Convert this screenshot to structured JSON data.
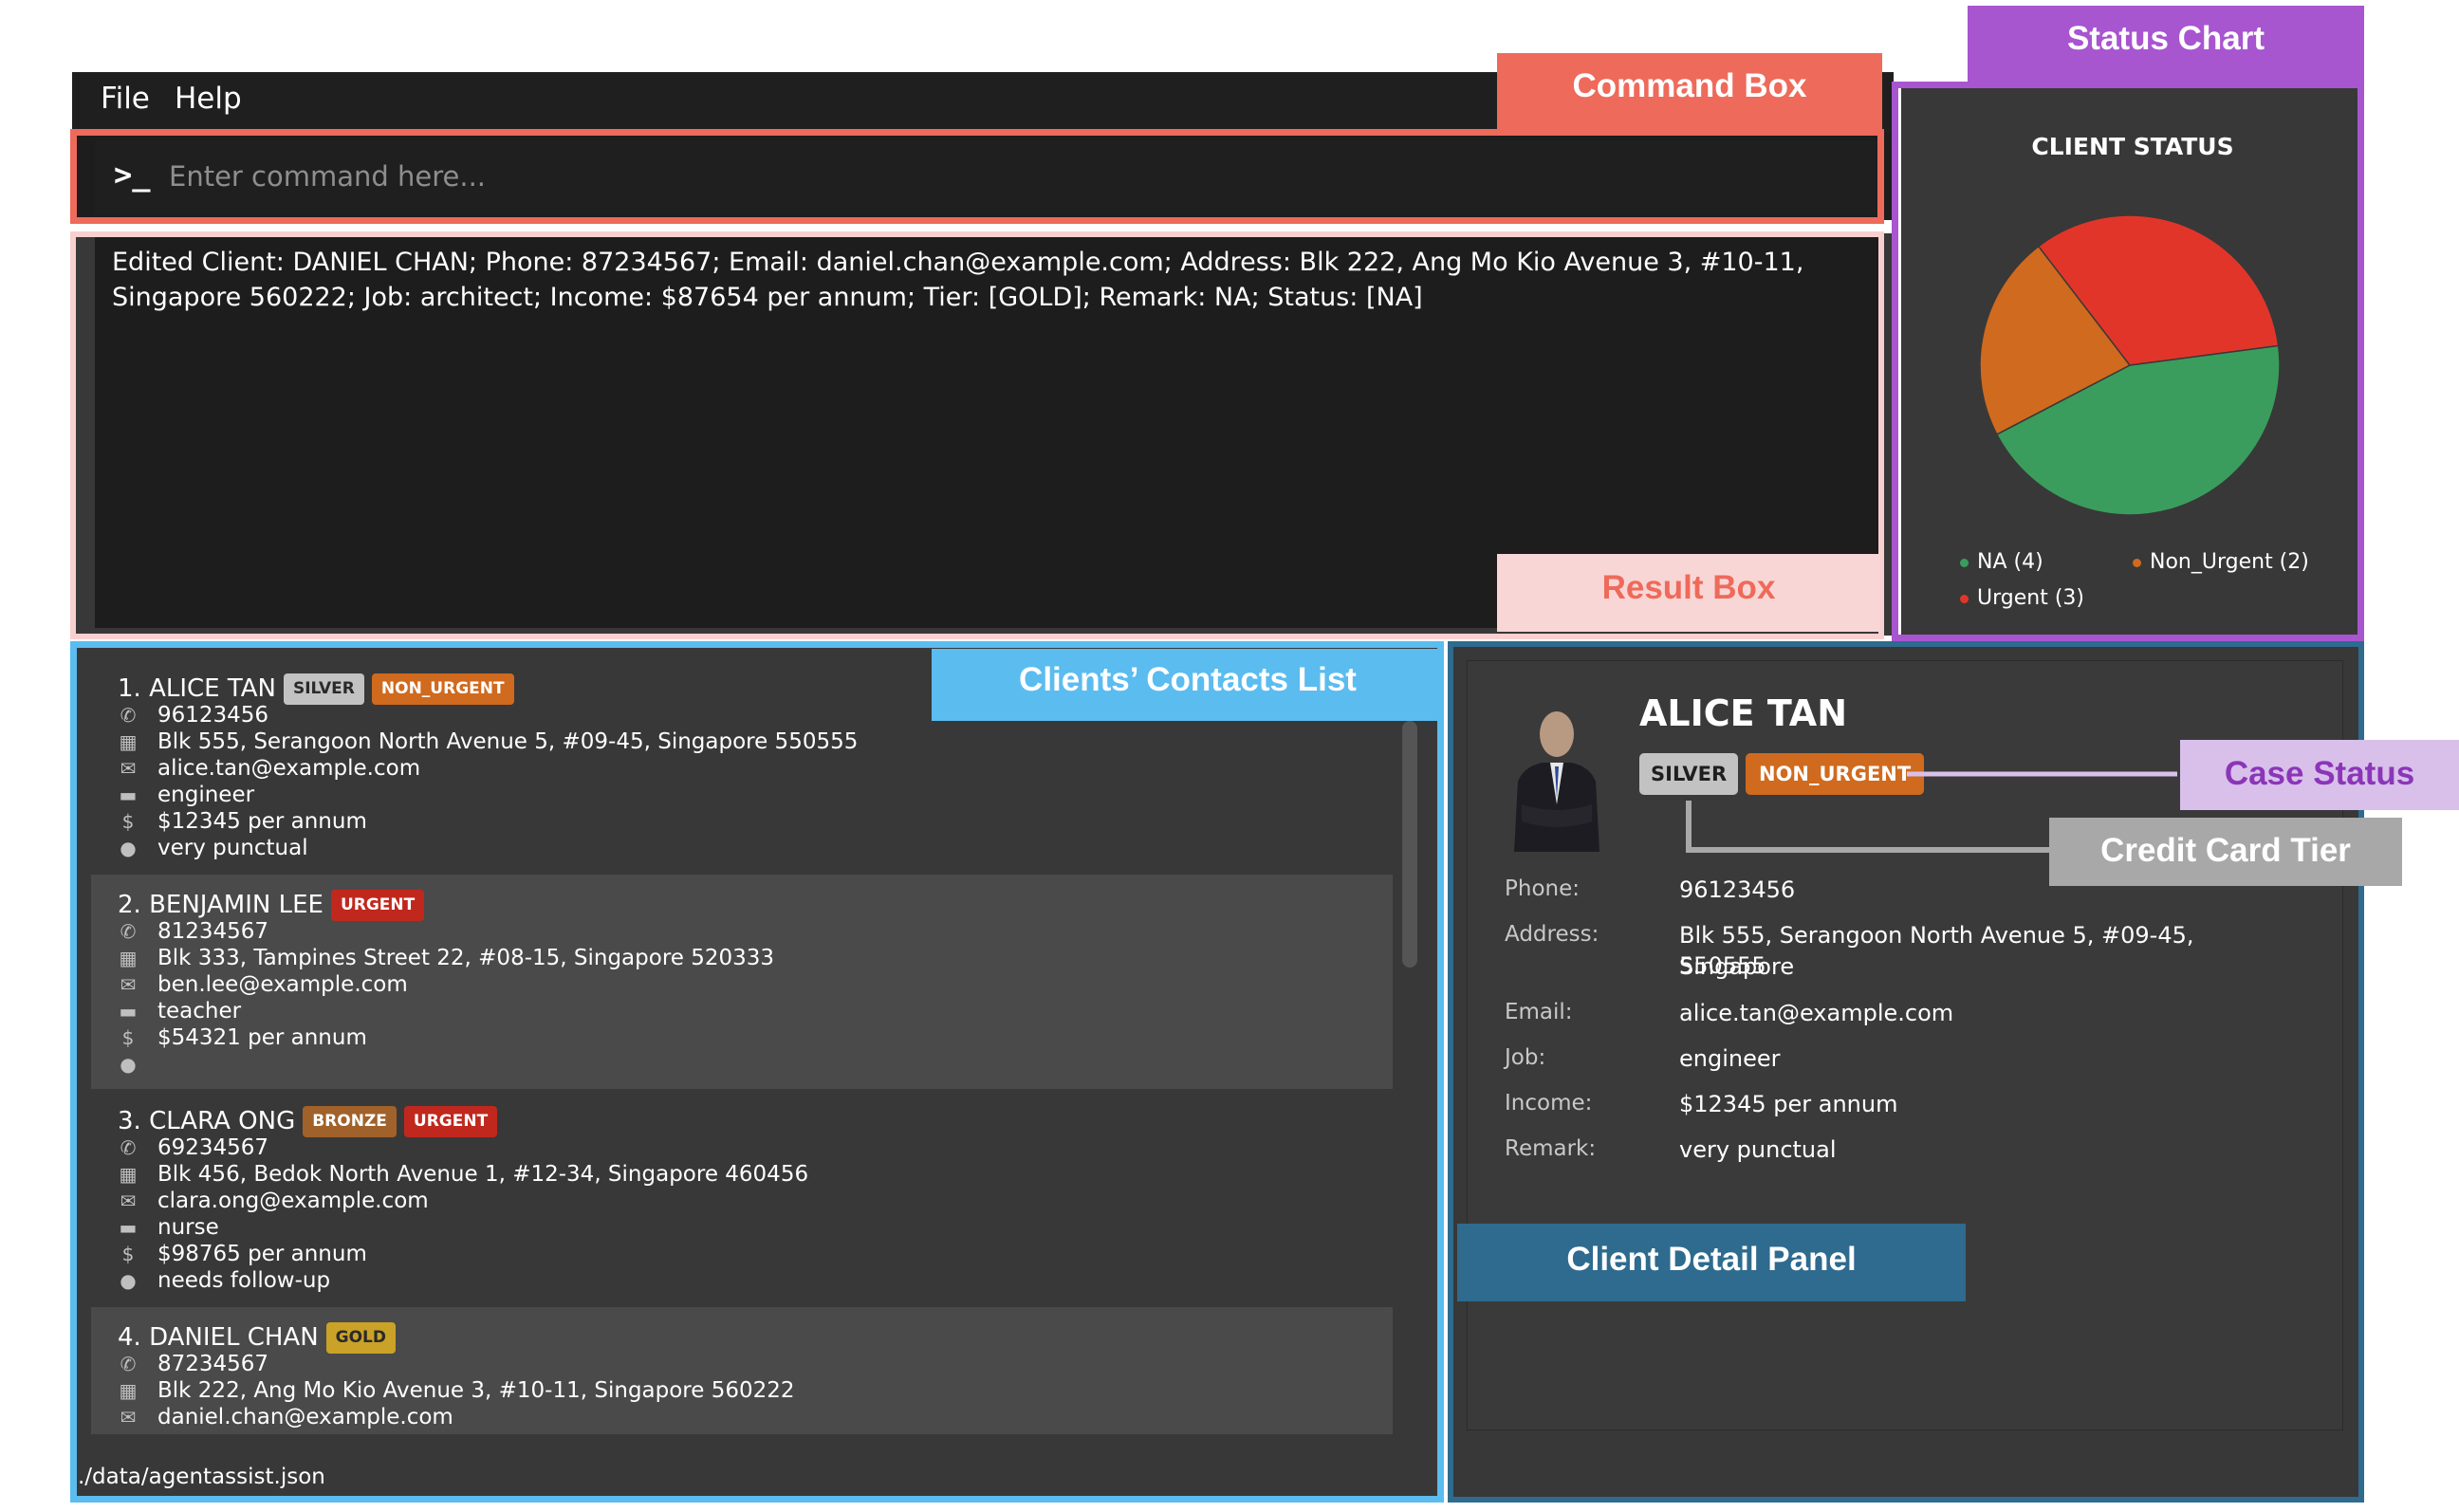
{
  "menu": {
    "items": [
      "File",
      "Help"
    ]
  },
  "command_box": {
    "placeholder": "Enter command here..."
  },
  "result_box": {
    "text": "Edited Client: DANIEL CHAN; Phone: 87234567; Email: daniel.chan@example.com; Address: Blk 222, Ang Mo Kio Avenue 3, #10-11, Singapore 560222; Job: architect; Income: $87654 per annum; Tier: [GOLD]; Remark: NA; Status: [NA]"
  },
  "status_chart": {
    "title": "CLIENT STATUS",
    "legend": [
      {
        "label": "NA (4)",
        "color": "#3a9d5d"
      },
      {
        "label": "Non_Urgent (2)",
        "color": "#d06a1e"
      },
      {
        "label": "Urgent (3)",
        "color": "#e2352a"
      }
    ]
  },
  "chart_data": {
    "type": "pie",
    "title": "CLIENT STATUS",
    "categories": [
      "NA",
      "Non_Urgent",
      "Urgent"
    ],
    "values": [
      4,
      2,
      3
    ],
    "colors": [
      "#3a9d5d",
      "#d06a1e",
      "#e2352a"
    ],
    "legend_position": "bottom"
  },
  "client_list": [
    {
      "index_name": "1. ALICE TAN",
      "tags": [
        {
          "label": "SILVER",
          "kind": "silver"
        },
        {
          "label": "NON_URGENT",
          "kind": "nonurgent"
        }
      ],
      "phone": "96123456",
      "address": "Blk 555, Serangoon North Avenue 5, #09-45, Singapore 550555",
      "email": "alice.tan@example.com",
      "job": "engineer",
      "income": "$12345 per annum",
      "remark": "very punctual"
    },
    {
      "index_name": "2. BENJAMIN LEE",
      "tags": [
        {
          "label": "URGENT",
          "kind": "urgent"
        }
      ],
      "phone": "81234567",
      "address": "Blk 333, Tampines Street 22, #08-15, Singapore 520333",
      "email": "ben.lee@example.com",
      "job": "teacher",
      "income": "$54321 per annum",
      "remark": ""
    },
    {
      "index_name": "3. CLARA ONG",
      "tags": [
        {
          "label": "BRONZE",
          "kind": "bronze"
        },
        {
          "label": "URGENT",
          "kind": "urgent"
        }
      ],
      "phone": "69234567",
      "address": "Blk 456, Bedok North Avenue 1, #12-34, Singapore 460456",
      "email": "clara.ong@example.com",
      "job": "nurse",
      "income": "$98765 per annum",
      "remark": "needs follow-up"
    },
    {
      "index_name": "4. DANIEL CHAN",
      "tags": [
        {
          "label": "GOLD",
          "kind": "gold"
        }
      ],
      "phone": "87234567",
      "address": "Blk 222, Ang Mo Kio Avenue 3, #10-11, Singapore 560222",
      "email": "daniel.chan@example.com",
      "job": "",
      "income": "",
      "remark": ""
    }
  ],
  "status_bar": {
    "file_path": "./data/agentassist.json"
  },
  "detail": {
    "name": "ALICE TAN",
    "tier": "SILVER",
    "status": "NON_URGENT",
    "labels": {
      "phone": "Phone:",
      "address": "Address:",
      "email": "Email:",
      "job": "Job:",
      "income": "Income:",
      "remark": "Remark:"
    },
    "phone": "96123456",
    "address_line1": "Blk 555, Serangoon North Avenue 5, #09-45, Singapore",
    "address_line2": "550555",
    "email": "alice.tan@example.com",
    "job": "engineer",
    "income": "$12345 per annum",
    "remark": "very punctual"
  },
  "annotations": {
    "command_box": "Command Box",
    "result_box": "Result Box",
    "status_chart": "Status Chart",
    "contacts_list": "Clients’ Contacts List",
    "detail_panel": "Client Detail Panel",
    "case_status": "Case Status",
    "credit_card_tier": "Credit Card Tier"
  },
  "colors": {
    "command": "#ee6a5a",
    "result": "#f8d6d6",
    "chart": "#a855d0",
    "list": "#5bbcf0",
    "detail": "#2e6b8e",
    "case_status": "#d8c0ea",
    "tier": "#a8a8a8"
  }
}
